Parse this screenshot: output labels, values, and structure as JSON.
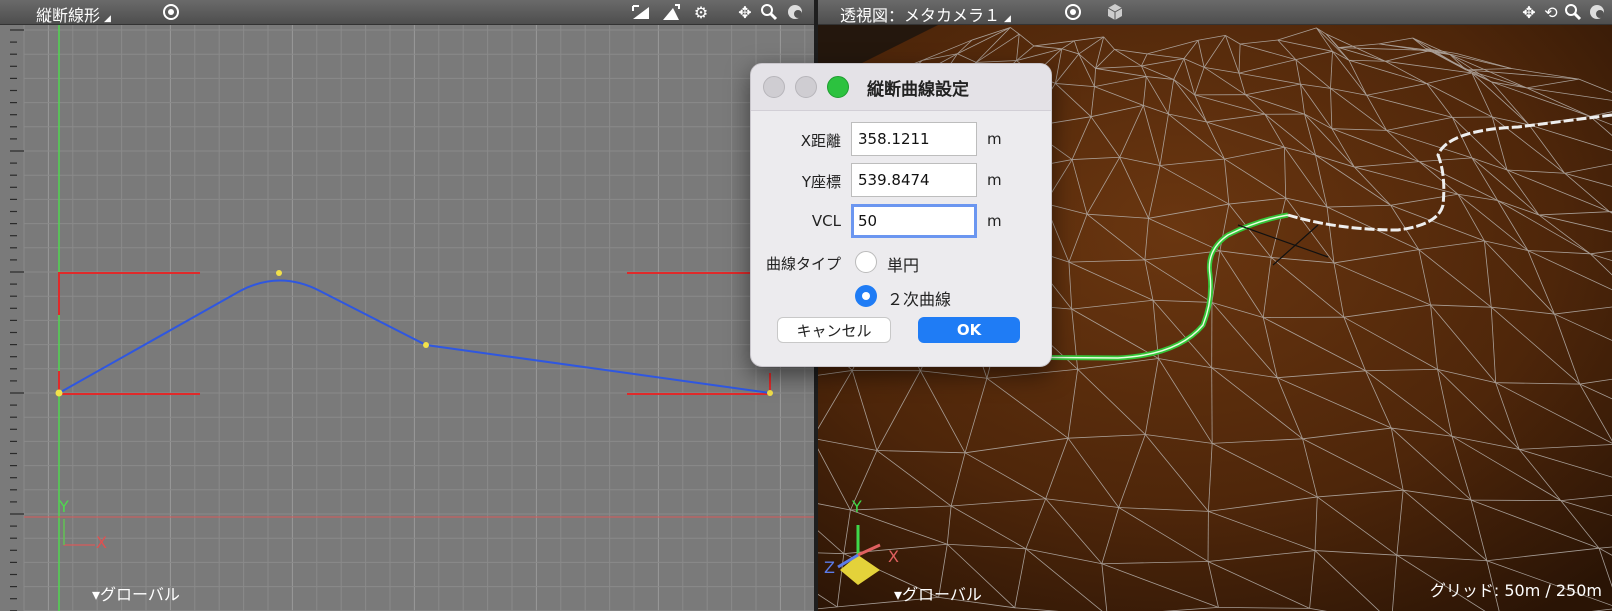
{
  "left_view": {
    "title": "縦断線形",
    "axis_y": "Y",
    "axis_x": "X",
    "coord_label": "▾グローバル"
  },
  "right_view": {
    "title": "透視図：メタカメラ１",
    "axis_y": "Y",
    "axis_x": "X",
    "axis_z": "Z",
    "coord_label": "▾グローバル",
    "grid_status": "グリッド: 50m / 250m"
  },
  "dialog": {
    "title": "縦断曲線設定",
    "x_label": "X距離",
    "x_value": "358.1211",
    "x_unit": "m",
    "y_label": "Y座標",
    "y_value": "539.8474",
    "y_unit": "m",
    "vcl_label": "VCL",
    "vcl_value": "50",
    "vcl_unit": "m",
    "curve_type_label": "曲線タイプ",
    "option_circle": "単円",
    "option_quadratic": "２次曲線",
    "selected_option": "２次曲線",
    "cancel_label": "キャンセル",
    "ok_label": "OK"
  },
  "colors": {
    "left_bg": "#7a7a7a",
    "terrain": "#5a2e0c",
    "profile_line": "#2f57e0",
    "bracket": "#e02a2a",
    "road_line": "#35c438",
    "accent": "#1f7cf5"
  }
}
